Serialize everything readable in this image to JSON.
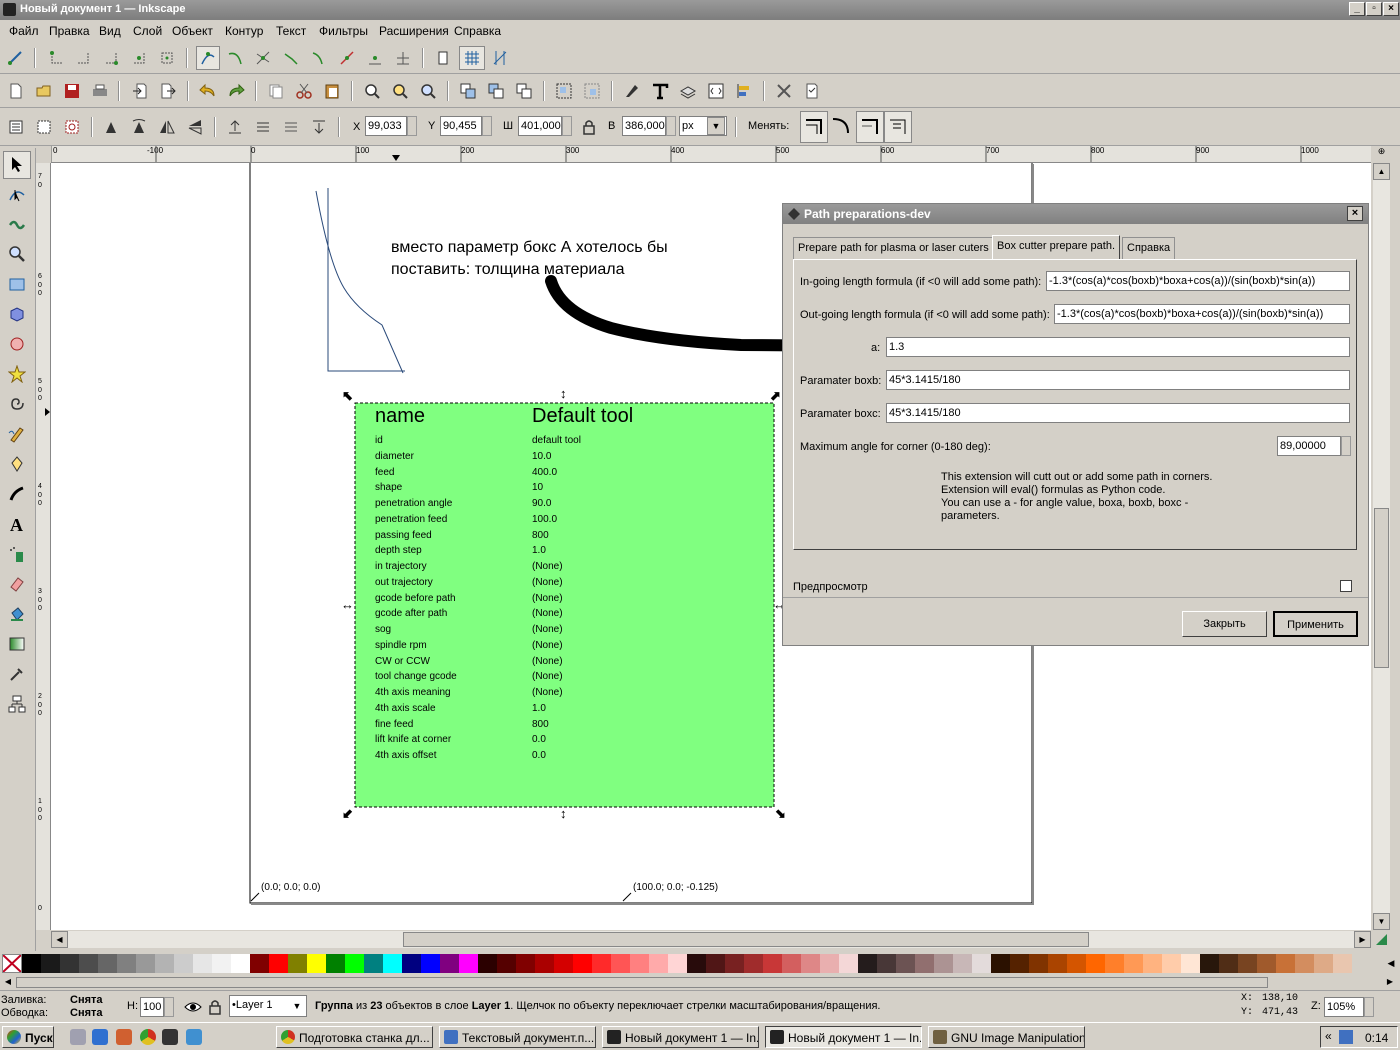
{
  "window": {
    "title": "Новый документ 1 — Inkscape"
  },
  "menu": [
    "Файл",
    "Правка",
    "Вид",
    "Слой",
    "Объект",
    "Контур",
    "Текст",
    "Фильтры",
    "Расширения",
    "Справка"
  ],
  "toolbar": {
    "x_label": "X",
    "x_value": "99,033",
    "y_label": "Y",
    "y_value": "90,455",
    "w_label": "Ш",
    "w_value": "401,000",
    "h_label": "В",
    "h_value": "386,000",
    "unit": "px",
    "change_label": "Менять:"
  },
  "ruler_h": [
    "0",
    "-100",
    "0",
    "100",
    "200",
    "300",
    "400",
    "500",
    "600",
    "700",
    "800",
    "900",
    "1000"
  ],
  "ruler_v": [
    "7",
    "0",
    "6",
    "0",
    "0",
    "5",
    "0",
    "0",
    "4",
    "0",
    "0",
    "3",
    "0",
    "0",
    "2",
    "0",
    "0",
    "1",
    "0",
    "0",
    "0"
  ],
  "canvas": {
    "annotation": "вместо параметр бокс А хотелось бы\nпоставить: толщина материала",
    "coord_left": "(0.0; 0.0; 0.0)",
    "coord_right": "(100.0; 0.0; -0.125)",
    "tool_table": {
      "header_name": "name",
      "header_value": "Default tool",
      "rows": [
        [
          "id",
          "default tool"
        ],
        [
          "diameter",
          "10.0"
        ],
        [
          "feed",
          "400.0"
        ],
        [
          "shape",
          "10"
        ],
        [
          "penetration angle",
          "90.0"
        ],
        [
          "penetration feed",
          "100.0"
        ],
        [
          "passing feed",
          "800"
        ],
        [
          "depth step",
          "1.0"
        ],
        [
          "in trajectory",
          "(None)"
        ],
        [
          "out trajectory",
          "(None)"
        ],
        [
          "gcode before path",
          "(None)"
        ],
        [
          "gcode after path",
          "(None)"
        ],
        [
          "sog",
          "(None)"
        ],
        [
          "spindle rpm",
          "(None)"
        ],
        [
          "CW or CCW",
          "(None)"
        ],
        [
          "tool change gcode",
          "(None)"
        ],
        [
          "4th axis meaning",
          "(None)"
        ],
        [
          "4th axis scale",
          "1.0"
        ],
        [
          "fine feed",
          "800"
        ],
        [
          "lift knife at corner",
          "0.0"
        ],
        [
          "4th axis offset",
          "0.0"
        ]
      ]
    }
  },
  "dialog": {
    "title": "Path preparations-dev",
    "tabs": [
      "Prepare path for plasma or laser cuters",
      "Box cutter prepare path.",
      "Справка"
    ],
    "ingoing_label": "In-going length formula (if <0 will add some path):",
    "ingoing_value": "-1.3*(cos(a)*cos(boxb)*boxa+cos(a))/(sin(boxb)*sin(a))",
    "outgoing_label": "Out-going length formula (if <0 will add some path):",
    "outgoing_value": "-1.3*(cos(a)*cos(boxb)*boxa+cos(a))/(sin(boxb)*sin(a))",
    "boxa_label": "a:",
    "boxa_value": "1.3",
    "boxb_label": "Paramater boxb:",
    "boxb_value": "45*3.1415/180",
    "boxc_label": "Paramater boxc:",
    "boxc_value": "45*3.1415/180",
    "maxangle_label": "Maximum angle for corner (0-180 deg):",
    "maxangle_value": "89,00000",
    "info": "This extension will cutt out or add some path in corners.\nExtension will eval() formulas as Python code.\nYou can use a - for angle value, boxa, boxb, boxc -\nparameters.",
    "preview_label": "Предпросмотр",
    "close_label": "Закрыть",
    "apply_label": "Применить"
  },
  "status": {
    "fill_label": "Заливка:",
    "fill_value": "Снята",
    "stroke_label": "Обводка:",
    "stroke_value": "Снята",
    "opacity_label": "Н:",
    "opacity_value": "100",
    "layer": "•Layer 1",
    "message_bold1": "Группа",
    "message_mid1": " из ",
    "message_bold2": "23",
    "message_mid2": " объектов в слое ",
    "message_bold3": "Layer 1",
    "message_tail": ". Щелчок по объекту переключает стрелки масштабирования/вращения.",
    "x_label": "X:",
    "x": "138,10",
    "y_label": "Y:",
    "y": "471,43",
    "zoom_label": "Z:",
    "zoom": "105%"
  },
  "taskbar": {
    "start": "Пуск",
    "tasks": [
      "Подготовка станка дл...",
      "Текстовый документ.п...",
      "Новый документ 1 — In...",
      "Новый документ 1 — In...",
      "GNU Image Manipulation ..."
    ],
    "clock": "0:14"
  },
  "palette_colors": [
    "#000000",
    "#1a1a1a",
    "#333333",
    "#4d4d4d",
    "#666666",
    "#808080",
    "#999999",
    "#b3b3b3",
    "#cccccc",
    "#e6e6e6",
    "#f2f2f2",
    "#ffffff",
    "#800000",
    "#ff0000",
    "#808000",
    "#ffff00",
    "#008000",
    "#00ff00",
    "#008080",
    "#00ffff",
    "#000080",
    "#0000ff",
    "#800080",
    "#ff00ff",
    "#2b0000",
    "#550000",
    "#800000",
    "#aa0000",
    "#d40000",
    "#ff0000",
    "#ff2a2a",
    "#ff5555",
    "#ff8080",
    "#ffaaaa",
    "#ffd5d5",
    "#280b0b",
    "#501616",
    "#782121",
    "#a02c2c",
    "#c83737",
    "#d35f5f",
    "#de8787",
    "#e9afaf",
    "#f4d7d7",
    "#241c1c",
    "#483737",
    "#6c5353",
    "#916f6f",
    "#ac9393",
    "#c8b7b7",
    "#e3dbdb",
    "#2b1100",
    "#552200",
    "#803300",
    "#aa4400",
    "#d45500",
    "#ff6600",
    "#ff7f2a",
    "#ff9955",
    "#ffb380",
    "#ffccaa",
    "#ffe6d5",
    "#28170b",
    "#502d16",
    "#784421",
    "#a05a2c",
    "#c87137",
    "#d38d5f",
    "#deaa87",
    "#e9c6af"
  ]
}
